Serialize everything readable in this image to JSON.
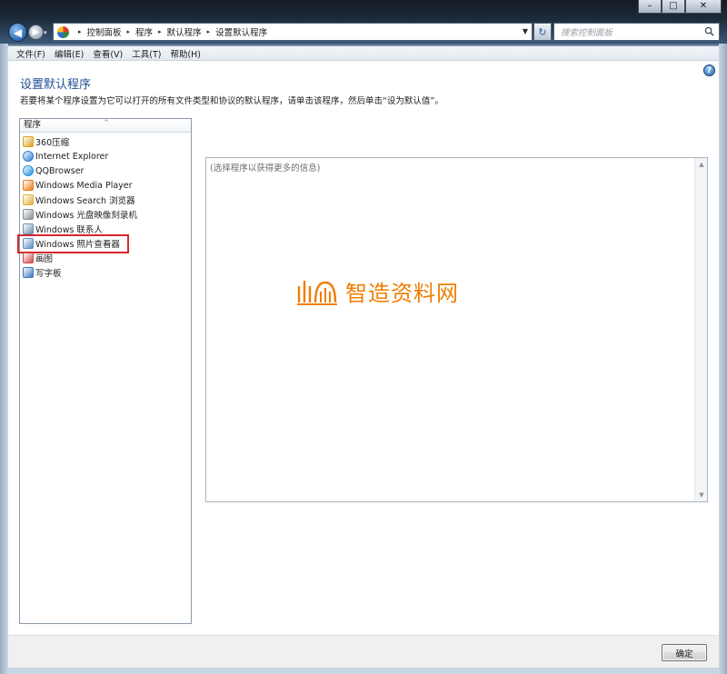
{
  "window": {
    "caption": {
      "minimize": "–",
      "maximize": "□",
      "close": "✕"
    }
  },
  "nav": {
    "back_glyph": "◀",
    "forward_glyph": "▶",
    "breadcrumbs": [
      "控制面板",
      "程序",
      "默认程序",
      "设置默认程序"
    ],
    "search_placeholder": "搜索控制面板",
    "refresh_glyph": "↻"
  },
  "menu": [
    {
      "label": "文件(F)"
    },
    {
      "label": "编辑(E)"
    },
    {
      "label": "查看(V)"
    },
    {
      "label": "工具(T)"
    },
    {
      "label": "帮助(H)"
    }
  ],
  "page": {
    "title": "设置默认程序",
    "description": "若要将某个程序设置为它可以打开的所有文件类型和协议的默认程序，请单击该程序，然后单击“设为默认值”。",
    "help_glyph": "?"
  },
  "programs": {
    "header": "程序",
    "items": [
      {
        "label": "360压缩",
        "icon": "archive-icon",
        "color": "#d9a21f"
      },
      {
        "label": "Internet Explorer",
        "icon": "ie-icon",
        "color": "#2a7fd4"
      },
      {
        "label": "QQBrowser",
        "icon": "qqbrowser-icon",
        "color": "#1f8de0"
      },
      {
        "label": "Windows Media Player",
        "icon": "media-player-icon",
        "color": "#e8801a"
      },
      {
        "label": "Windows Search 浏览器",
        "icon": "search-explorer-icon",
        "color": "#e2b13c"
      },
      {
        "label": "Windows 光盘映像刻录机",
        "icon": "disc-burner-icon",
        "color": "#8a8f96"
      },
      {
        "label": "Windows 联系人",
        "icon": "contacts-icon",
        "color": "#6f8fb3"
      },
      {
        "label": "Windows 照片查看器",
        "icon": "photo-viewer-icon",
        "color": "#5a8fc4",
        "highlighted": true
      },
      {
        "label": "画图",
        "icon": "paint-icon",
        "color": "#d24b4b"
      },
      {
        "label": "写字板",
        "icon": "wordpad-icon",
        "color": "#3e77c2"
      }
    ]
  },
  "info": {
    "placeholder": "(选择程序以获得更多的信息)"
  },
  "watermark": {
    "text": "智造资料网",
    "color": "#ef7d00"
  },
  "footer": {
    "ok_label": "确定"
  },
  "colors": {
    "highlight_border": "#d8262d",
    "title": "#1f4e93"
  }
}
